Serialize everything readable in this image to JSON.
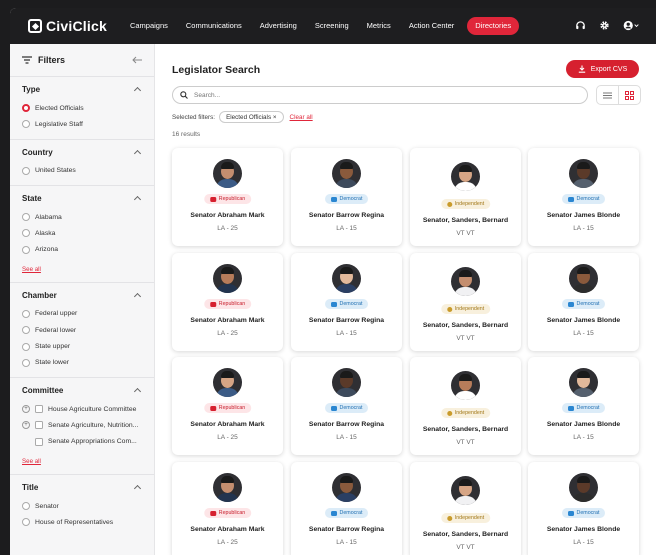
{
  "nav": {
    "logo": "CiviClick",
    "items": [
      "Campaigns",
      "Communications",
      "Advertising",
      "Screening",
      "Metrics",
      "Action Center"
    ],
    "active": "Directories"
  },
  "sidebar": {
    "title": "Filters",
    "type": {
      "title": "Type",
      "options": [
        "Elected Officials",
        "Legislative Staff"
      ]
    },
    "country": {
      "title": "Country",
      "options": [
        "United States"
      ]
    },
    "state": {
      "title": "State",
      "options": [
        "Alabama",
        "Alaska",
        "Arizona"
      ],
      "see_all": "See all"
    },
    "chamber": {
      "title": "Chamber",
      "options": [
        "Federal upper",
        "Federal lower",
        "State upper",
        "State lower"
      ]
    },
    "committee": {
      "title": "Committee",
      "options": [
        "House Agriculture Committee",
        "Senate Agriculture, Nutrition...",
        "Senate Appropriations Com..."
      ],
      "see_all": "See all"
    },
    "title_section": {
      "title": "Title",
      "options": [
        "Senator",
        "House of Representatives"
      ]
    }
  },
  "main": {
    "title": "Legislator Search",
    "export_label": "Export CVS",
    "search_placeholder": "Search...",
    "selected_filters_label": "Selected filters:",
    "filter_chip": "Elected Officials",
    "chip_close": "×",
    "clear_all": "Clear all",
    "results_count": "16 results"
  },
  "colors": {
    "accent": "#e0263a",
    "republican": "#d6202f",
    "democrat": "#2a86d1",
    "independent": "#c99b2b"
  },
  "cards": [
    {
      "name": "Senator Abraham Mark",
      "district": "LA - 25",
      "party": "Republican"
    },
    {
      "name": "Senator Barrow Regina",
      "district": "LA - 15",
      "party": "Democrat"
    },
    {
      "name": "Senator, Sanders, Bernard",
      "district": "VT VT",
      "party": "Independent"
    },
    {
      "name": "Senator James Blonde",
      "district": "LA - 15",
      "party": "Democrat"
    },
    {
      "name": "Senator Abraham Mark",
      "district": "LA - 25",
      "party": "Republican"
    },
    {
      "name": "Senator Barrow Regina",
      "district": "LA - 15",
      "party": "Democrat"
    },
    {
      "name": "Senator, Sanders, Bernard",
      "district": "VT VT",
      "party": "Independent"
    },
    {
      "name": "Senator James Blonde",
      "district": "LA - 15",
      "party": "Democrat"
    },
    {
      "name": "Senator Abraham Mark",
      "district": "LA - 25",
      "party": "Republican"
    },
    {
      "name": "Senator Barrow Regina",
      "district": "LA - 15",
      "party": "Democrat"
    },
    {
      "name": "Senator, Sanders, Bernard",
      "district": "VT VT",
      "party": "Independent"
    },
    {
      "name": "Senator James Blonde",
      "district": "LA - 15",
      "party": "Democrat"
    },
    {
      "name": "Senator Abraham Mark",
      "district": "LA - 25",
      "party": "Republican"
    },
    {
      "name": "Senator Barrow Regina",
      "district": "LA - 15",
      "party": "Democrat"
    },
    {
      "name": "Senator, Sanders, Bernard",
      "district": "VT VT",
      "party": "Independent"
    },
    {
      "name": "Senator James Blonde",
      "district": "LA - 15",
      "party": "Democrat"
    }
  ]
}
